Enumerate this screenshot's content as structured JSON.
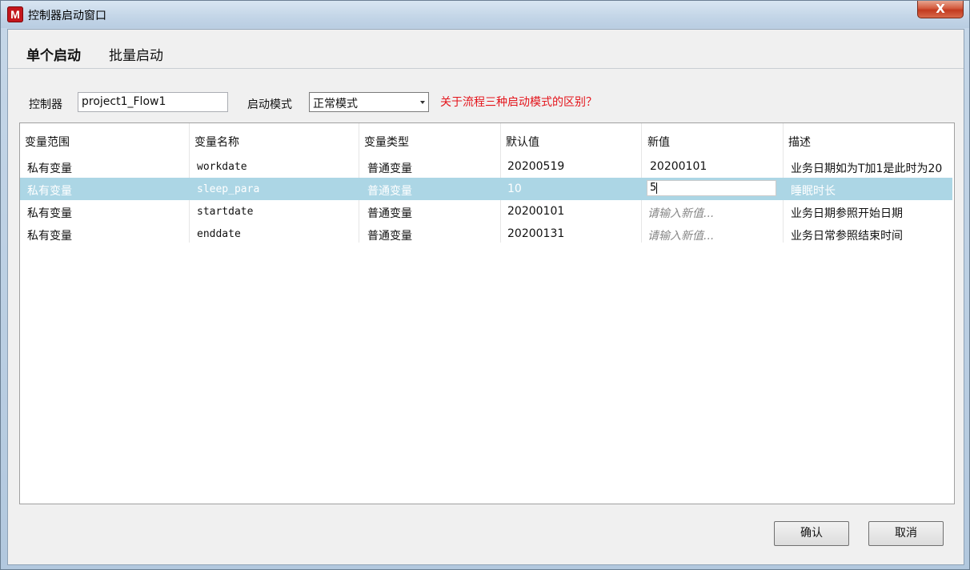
{
  "window": {
    "title": "控制器启动窗口",
    "close_label": "X"
  },
  "tabs": [
    {
      "label": "单个启动",
      "active": true
    },
    {
      "label": "批量启动",
      "active": false
    }
  ],
  "form": {
    "controller_label": "控制器",
    "controller_value": "project1_Flow1",
    "mode_label": "启动模式",
    "mode_value": "正常模式",
    "help_link": "关于流程三种启动模式的区别？"
  },
  "table": {
    "columns": [
      "变量范围",
      "变量名称",
      "变量类型",
      "默认值",
      "新值",
      "描述"
    ],
    "rows": [
      {
        "scope": "私有变量",
        "name": "workdate",
        "type": "普通变量",
        "default": "20200519",
        "new_value": "20200101",
        "desc": "业务日期如为T加1是此时为20"
      },
      {
        "scope": "私有变量",
        "name": "sleep_para",
        "type": "普通变量",
        "default": "10",
        "new_value": "5",
        "desc": "睡眠时长"
      },
      {
        "scope": "私有变量",
        "name": "startdate",
        "type": "普通变量",
        "default": "20200101",
        "new_value": "请输入新值...",
        "desc": "业务日期参照开始日期"
      },
      {
        "scope": "私有变量",
        "name": "enddate",
        "type": "普通变量",
        "default": "20200131",
        "new_value": "请输入新值...",
        "desc": "业务日常参照结束时间"
      }
    ],
    "selected_row": 1
  },
  "buttons": {
    "ok": "确认",
    "cancel": "取消"
  },
  "colors": {
    "selection": "#acd6e5",
    "link": "#e4141b",
    "close": "#c23a1f"
  }
}
